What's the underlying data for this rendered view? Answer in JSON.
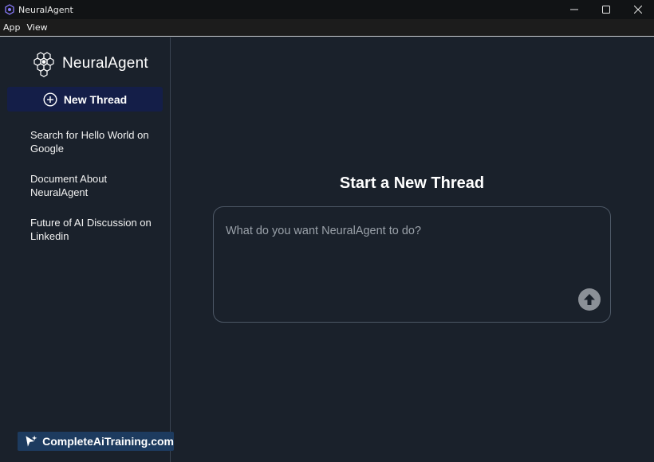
{
  "window": {
    "title": "NeuralAgent",
    "icon": "app-logo-icon"
  },
  "menu": {
    "items": [
      {
        "label": "App"
      },
      {
        "label": "View"
      }
    ]
  },
  "sidebar": {
    "logo_text": "NeuralAgent",
    "new_thread_label": "New Thread",
    "threads": [
      {
        "title": "Search for Hello World on Google"
      },
      {
        "title": "Document About NeuralAgent"
      },
      {
        "title": "Future of AI Discussion on Linkedin"
      }
    ]
  },
  "main": {
    "heading": "Start a New Thread",
    "prompt": {
      "placeholder": "What do you want NeuralAgent to do?",
      "value": ""
    },
    "send_icon": "arrow-up-icon"
  },
  "watermark": {
    "text": "CompleteAiTraining.com"
  },
  "colors": {
    "background": "#1a212b",
    "new_thread_button": "#141e48",
    "send_button": "#8b9097",
    "watermark_bg": "#1d3b5f"
  }
}
